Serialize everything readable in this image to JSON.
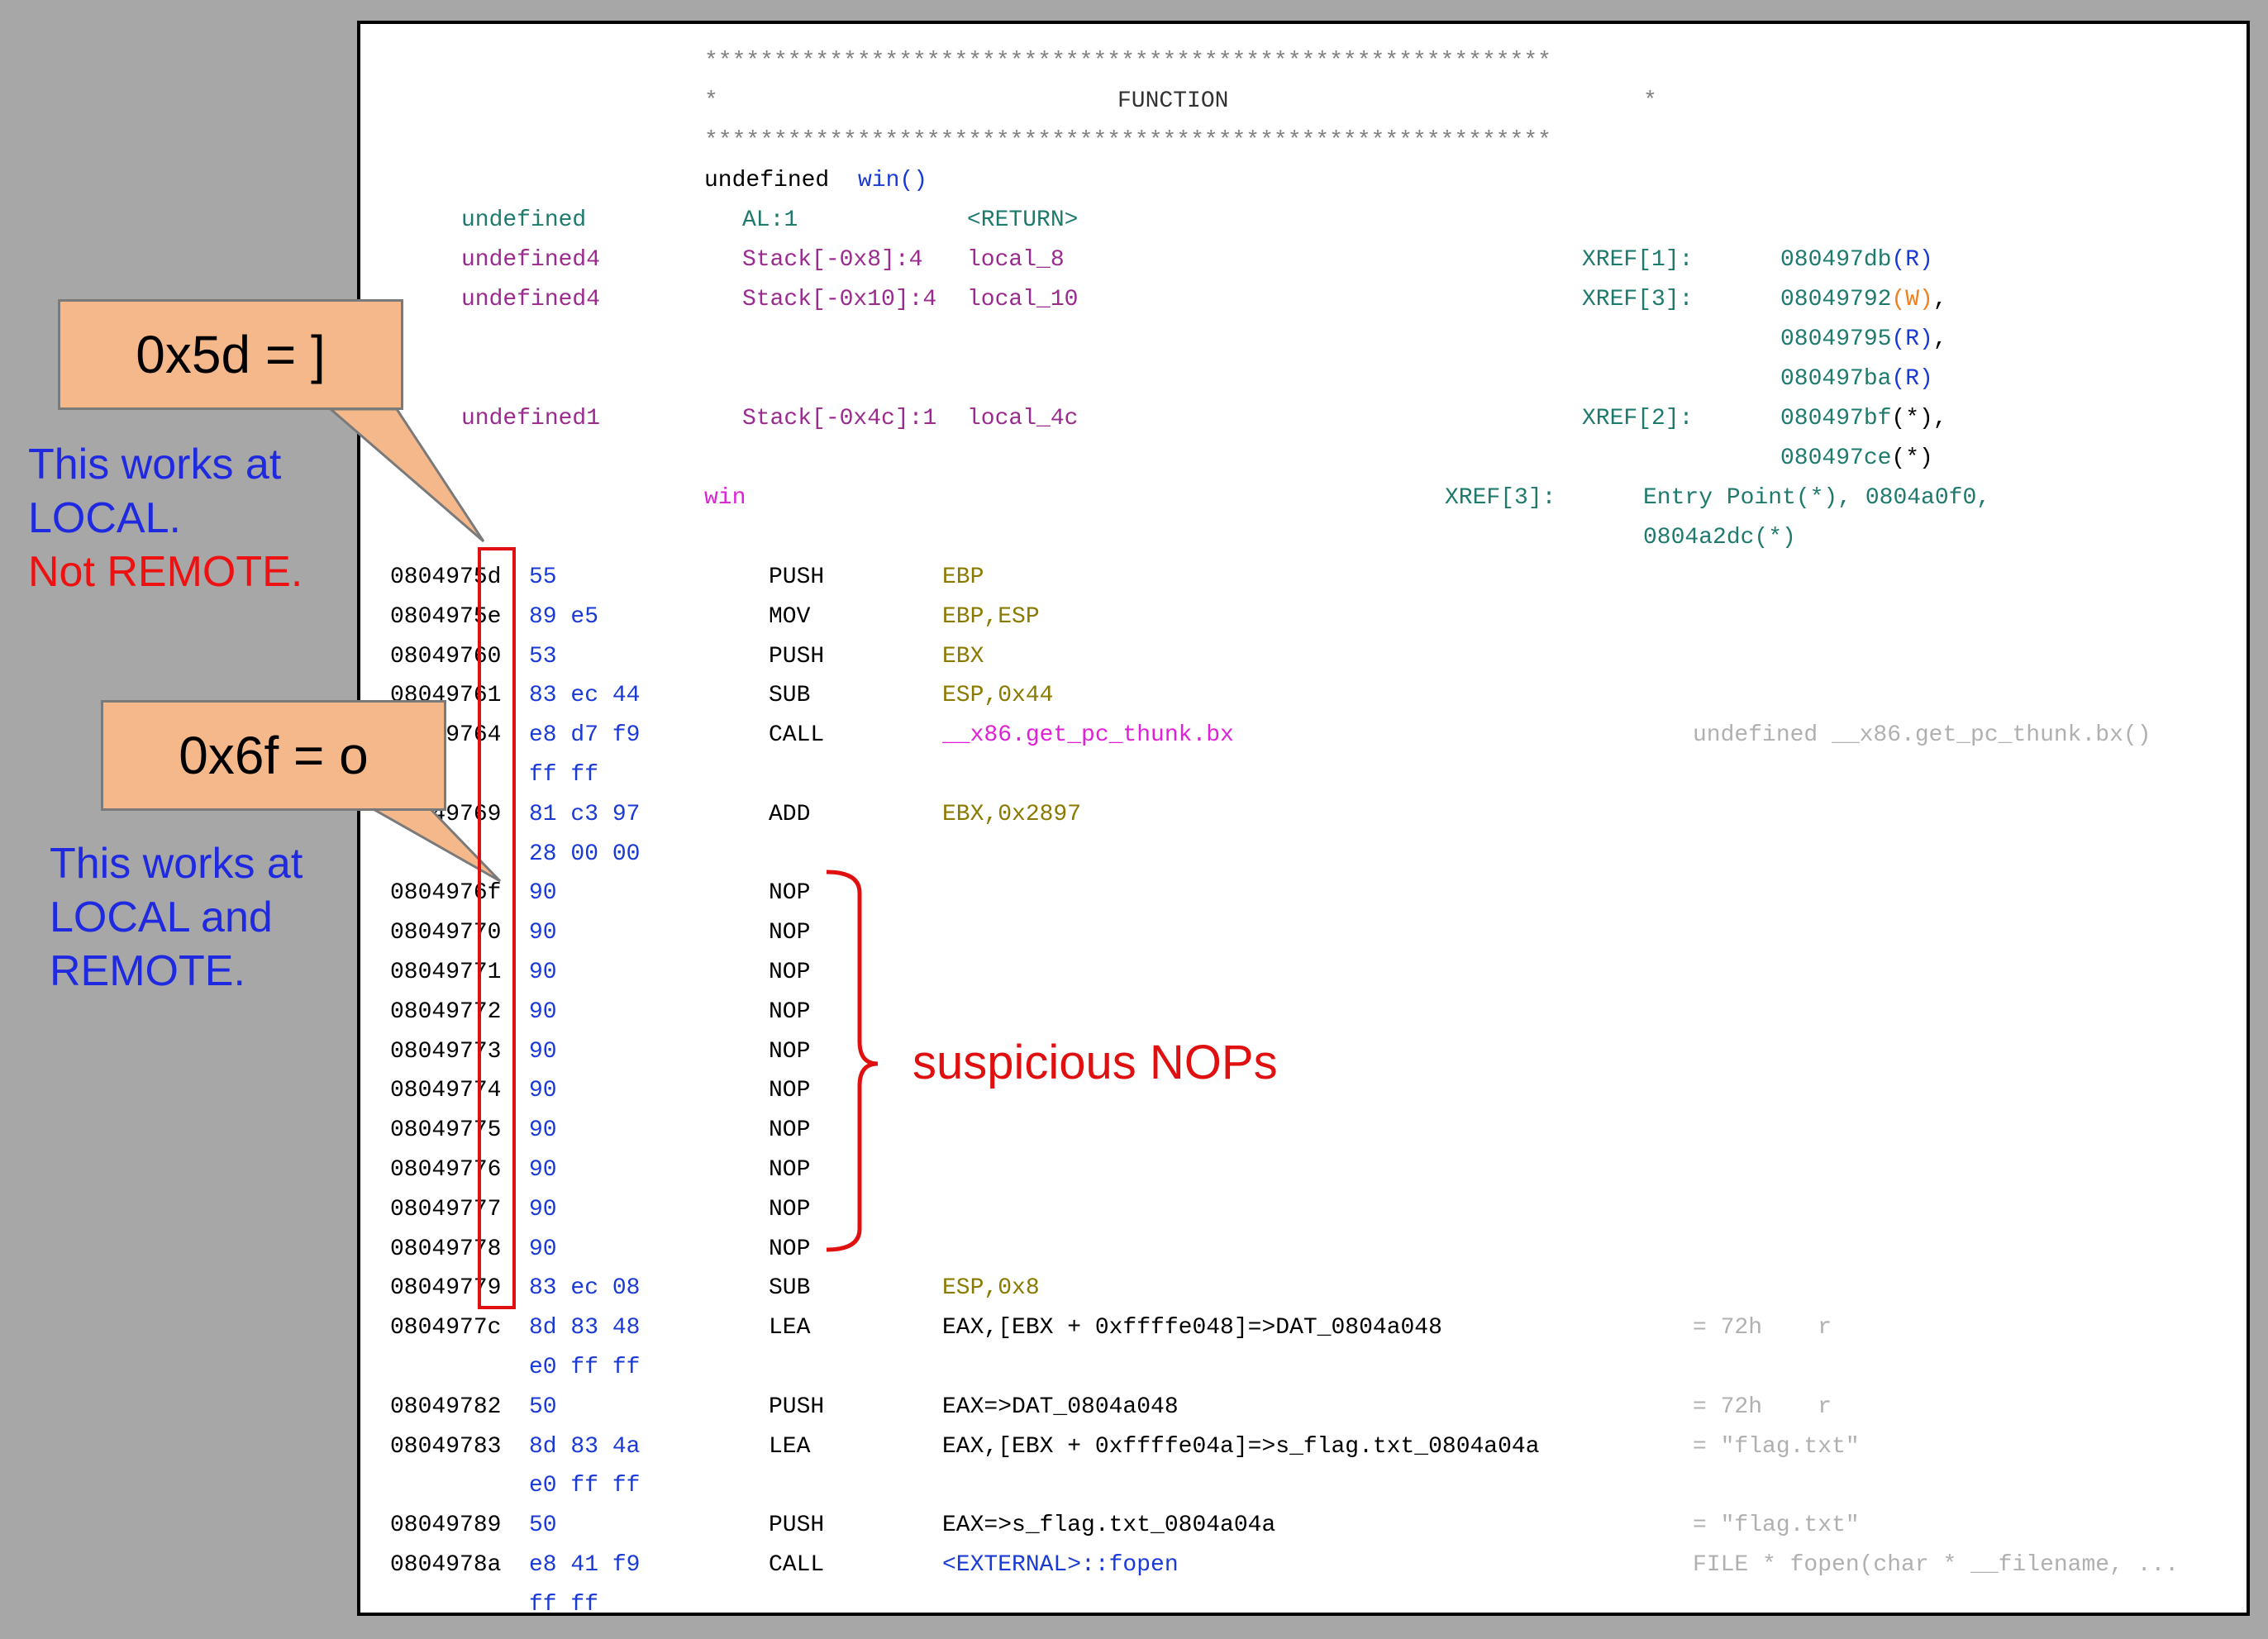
{
  "header": {
    "stars": "*************************************************************",
    "function_line_left": "*",
    "function_label": "FUNCTION",
    "function_line_right": "*",
    "signature_type": "undefined",
    "signature_name": "win()"
  },
  "vars": [
    {
      "type": "undefined",
      "storage": "AL:1",
      "name": "<RETURN>",
      "xref_label": "",
      "xrefs": []
    },
    {
      "type": "undefined4",
      "storage": "Stack[-0x8]:4",
      "name": "local_8",
      "xref_label": "XREF[1]:",
      "xrefs": [
        {
          "addr": "080497db",
          "kind": "(R)"
        }
      ]
    },
    {
      "type": "undefined4",
      "storage": "Stack[-0x10]:4",
      "name": "local_10",
      "xref_label": "XREF[3]:",
      "xrefs": [
        {
          "addr": "08049792",
          "kind": "(W)",
          "sep": ","
        },
        {
          "addr": "08049795",
          "kind": "(R)",
          "sep": ","
        },
        {
          "addr": "080497ba",
          "kind": "(R)"
        }
      ]
    },
    {
      "type": "undefined1",
      "storage": "Stack[-0x4c]:1",
      "name": "local_4c",
      "xref_label": "XREF[2]:",
      "xrefs": [
        {
          "addr": "080497bf",
          "kind": "(*)",
          "sep": ","
        },
        {
          "addr": "080497ce",
          "kind": "(*)"
        }
      ]
    }
  ],
  "label": {
    "name": "win",
    "xref_label": "XREF[3]:",
    "xref_line1": "Entry Point(*), 0804a0f0,",
    "xref_line2": "0804a2dc(*)"
  },
  "listing": [
    {
      "addr": "0804975d",
      "bytes": "55",
      "mnem": "PUSH",
      "op": "EBP",
      "cmt": ""
    },
    {
      "addr": "0804975e",
      "bytes": "89 e5",
      "mnem": "MOV",
      "op": "EBP,ESP",
      "cmt": ""
    },
    {
      "addr": "08049760",
      "bytes": "53",
      "mnem": "PUSH",
      "op": "EBX",
      "cmt": ""
    },
    {
      "addr": "08049761",
      "bytes": "83 ec 44",
      "mnem": "SUB",
      "op": "ESP,0x44",
      "cmt": ""
    },
    {
      "addr": "08049764",
      "bytes": "e8 d7 f9",
      "mnem": "CALL",
      "op": "__x86.get_pc_thunk.bx",
      "cmt": "undefined __x86.get_pc_thunk.bx()"
    },
    {
      "addr": "",
      "bytes": "ff ff",
      "mnem": "",
      "op": "",
      "cmt": ""
    },
    {
      "addr": "08049769",
      "bytes": "81 c3 97",
      "mnem": "ADD",
      "op": "EBX,0x2897",
      "cmt": ""
    },
    {
      "addr": "",
      "bytes": "28 00 00",
      "mnem": "",
      "op": "",
      "cmt": ""
    },
    {
      "addr": "0804976f",
      "bytes": "90",
      "mnem": "NOP",
      "op": "",
      "cmt": ""
    },
    {
      "addr": "08049770",
      "bytes": "90",
      "mnem": "NOP",
      "op": "",
      "cmt": ""
    },
    {
      "addr": "08049771",
      "bytes": "90",
      "mnem": "NOP",
      "op": "",
      "cmt": ""
    },
    {
      "addr": "08049772",
      "bytes": "90",
      "mnem": "NOP",
      "op": "",
      "cmt": ""
    },
    {
      "addr": "08049773",
      "bytes": "90",
      "mnem": "NOP",
      "op": "",
      "cmt": ""
    },
    {
      "addr": "08049774",
      "bytes": "90",
      "mnem": "NOP",
      "op": "",
      "cmt": ""
    },
    {
      "addr": "08049775",
      "bytes": "90",
      "mnem": "NOP",
      "op": "",
      "cmt": ""
    },
    {
      "addr": "08049776",
      "bytes": "90",
      "mnem": "NOP",
      "op": "",
      "cmt": ""
    },
    {
      "addr": "08049777",
      "bytes": "90",
      "mnem": "NOP",
      "op": "",
      "cmt": ""
    },
    {
      "addr": "08049778",
      "bytes": "90",
      "mnem": "NOP",
      "op": "",
      "cmt": ""
    },
    {
      "addr": "08049779",
      "bytes": "83 ec 08",
      "mnem": "SUB",
      "op": "ESP,0x8",
      "cmt": ""
    },
    {
      "addr": "0804977c",
      "bytes": "8d 83 48",
      "mnem": "LEA",
      "op": "EAX,[EBX + 0xffffe048]=>DAT_0804a048",
      "cmt": "= 72h    r"
    },
    {
      "addr": "",
      "bytes": "e0 ff ff",
      "mnem": "",
      "op": "",
      "cmt": ""
    },
    {
      "addr": "08049782",
      "bytes": "50",
      "mnem": "PUSH",
      "op": "EAX=>DAT_0804a048",
      "cmt": "= 72h    r"
    },
    {
      "addr": "08049783",
      "bytes": "8d 83 4a",
      "mnem": "LEA",
      "op": "EAX,[EBX + 0xffffe04a]=>s_flag.txt_0804a04a",
      "cmt": "= \"flag.txt\""
    },
    {
      "addr": "",
      "bytes": "e0 ff ff",
      "mnem": "",
      "op": "",
      "cmt": ""
    },
    {
      "addr": "08049789",
      "bytes": "50",
      "mnem": "PUSH",
      "op": "EAX=>s_flag.txt_0804a04a",
      "cmt": "= \"flag.txt\""
    },
    {
      "addr": "0804978a",
      "bytes": "e8 41 f9",
      "mnem": "CALL",
      "op": "<EXTERNAL>::fopen",
      "cmt": "FILE * fopen(char * __filename, ..."
    },
    {
      "addr": "",
      "bytes": "ff ff",
      "mnem": "",
      "op": "",
      "cmt": ""
    }
  ],
  "callouts": {
    "top": {
      "text": "0x5d = ]",
      "note_line1": "This works at",
      "note_line2": "LOCAL.",
      "note_line3": "Not REMOTE."
    },
    "bottom": {
      "text": "0x6f = o",
      "note_line1": "This works at",
      "note_line2": "LOCAL and",
      "note_line3": "REMOTE."
    },
    "nops": "suspicious NOPs"
  },
  "colors": {
    "highlight_red": "#e01010",
    "callout_fill": "#f5b88b",
    "note_blue": "#1f2ae0",
    "note_red": "#ee1111"
  }
}
